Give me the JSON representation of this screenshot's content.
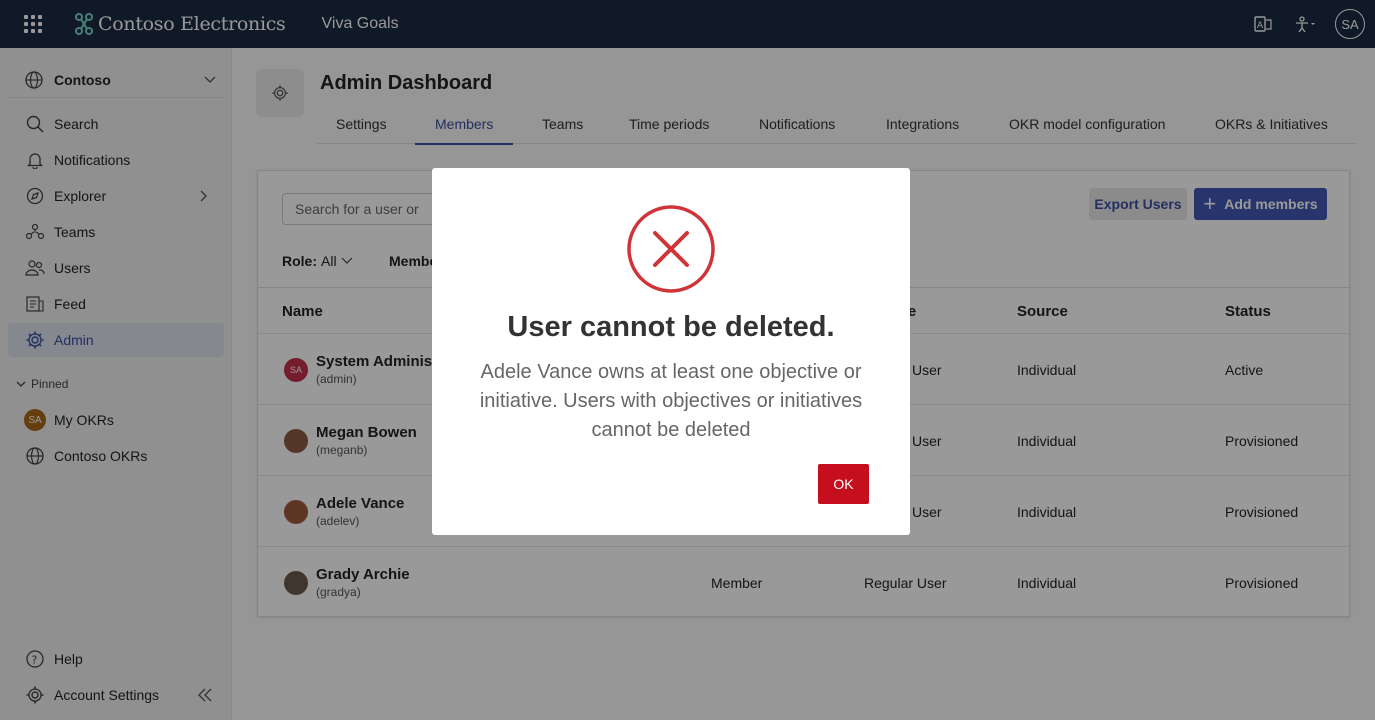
{
  "topbar": {
    "brand": "Contoso Electronics",
    "app_name": "Viva Goals",
    "avatar": "SA",
    "icons": [
      "app-launcher-icon",
      "immersive-reader-icon",
      "accessibility-icon"
    ]
  },
  "sidebar": {
    "org": "Contoso",
    "items": [
      {
        "label": "Search",
        "icon": "search-icon"
      },
      {
        "label": "Notifications",
        "icon": "bell-icon"
      },
      {
        "label": "Explorer",
        "icon": "compass-icon"
      },
      {
        "label": "Teams",
        "icon": "teams-icon"
      },
      {
        "label": "Users",
        "icon": "users-icon"
      },
      {
        "label": "Feed",
        "icon": "feed-icon"
      },
      {
        "label": "Admin",
        "icon": "gear-icon"
      }
    ],
    "pinned_label": "Pinned",
    "pinned": [
      {
        "label": "My OKRs",
        "badge": "SA"
      },
      {
        "label": "Contoso OKRs"
      }
    ],
    "help": "Help",
    "account_settings": "Account Settings"
  },
  "main": {
    "title": "Admin Dashboard",
    "tabs": [
      "Settings",
      "Members",
      "Teams",
      "Time periods",
      "Notifications",
      "Integrations",
      "OKR model configuration",
      "OKRs & Initiatives"
    ],
    "active_tab": "Members",
    "search_placeholder": "Search for a user or",
    "export_label": "Export Users",
    "add_label": "Add members",
    "filter_role_label": "Role:",
    "filter_role_value": "All",
    "filter_member_label": "Member",
    "columns": {
      "name": "Name",
      "user_type": "er Type",
      "source": "Source",
      "status": "Status"
    },
    "rows": [
      {
        "name": "System Adminis",
        "handle": "(admin)",
        "avatar": "SA",
        "role": "",
        "user_type": "User",
        "source": "Individual",
        "status": "Active"
      },
      {
        "name": "Megan Bowen",
        "handle": "(meganb)",
        "avatar": "",
        "role": "",
        "user_type": "User",
        "source": "Individual",
        "status": "Provisioned"
      },
      {
        "name": "Adele Vance",
        "handle": "(adelev)",
        "avatar": "",
        "role": "",
        "user_type": "User",
        "source": "Individual",
        "status": "Provisioned"
      },
      {
        "name": "Grady Archie",
        "handle": "(gradya)",
        "avatar": "",
        "role": "Member",
        "user_type": "Regular User",
        "source": "Individual",
        "status": "Provisioned"
      }
    ]
  },
  "modal": {
    "title": "User cannot be deleted.",
    "message": "Adele Vance owns at least one objective or initiative. Users with objectives or initiatives cannot be deleted",
    "ok_label": "OK",
    "icon": "error-x-icon",
    "accent_color": "#d13438",
    "button_color": "#c50f1f"
  }
}
